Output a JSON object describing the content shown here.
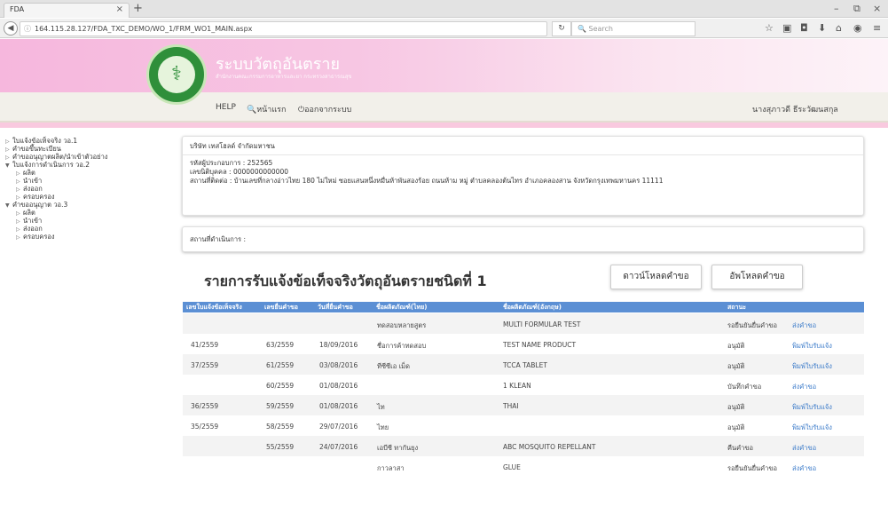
{
  "browser": {
    "tab_title": "FDA",
    "tab_close": "×",
    "new_tab": "+",
    "url": "164.115.28.127/FDA_TXC_DEMO/WO_1/FRM_WO1_MAIN.aspx",
    "search_placeholder": "Search",
    "window_controls": [
      "–",
      "⧉",
      "×"
    ]
  },
  "header": {
    "system_title": "ระบบวัตถุอันตราย",
    "system_subtitle": "สำนักงานคณะกรรมการอาหารและยา กระทรวงสาธารณสุข"
  },
  "menu": {
    "help": "HELP",
    "home": "หน้าแรก",
    "logout": "ออกจากระบบ",
    "user_name": "นางสุภาวดี ธีระวัฒนสกุล"
  },
  "sidebar": {
    "items": [
      {
        "label": "ใบแจ้งข้อเท็จจริง วอ.1",
        "expanded": false,
        "children": []
      },
      {
        "label": "คำขอขึ้นทะเบียน",
        "expanded": false,
        "children": []
      },
      {
        "label": "คำขออนุญาตผลิต/นำเข้าตัวอย่าง",
        "expanded": false,
        "children": []
      },
      {
        "label": "ใบแจ้งการดำเนินการ วอ.2",
        "expanded": true,
        "children": [
          "ผลิต",
          "นำเข้า",
          "ส่งออก",
          "ครอบครอง"
        ]
      },
      {
        "label": "คำขออนุญาต วอ.3",
        "expanded": true,
        "children": [
          "ผลิต",
          "นำเข้า",
          "ส่งออก",
          "ครอบครอง"
        ]
      }
    ]
  },
  "company": {
    "name": "บริษัท เทสโฮลด์ จำกัดมหาชน",
    "operator_id": "รหัสผู้ประกอบการ : 252565",
    "juristic_id": "เลขนิติบุคคล : 0000000000000",
    "address": "สถานที่ติดต่อ : บ้านเลขที่กลางอ่าวไทย 180 ไม่ใหม่ ซอยแสนหนึ่งหมื่นห้าพันสองร้อย ถนนห้าม หมู่ ตำบลคลองต้นไทร อำเภอคลองสาน จังหวัดกรุงเทพมหานคร 11111"
  },
  "location": {
    "label": "สถานที่ดำเนินการ :"
  },
  "main": {
    "title": "รายการรับแจ้งข้อเท็จจริงวัตถุอันตรายชนิดที่ 1",
    "download_button": "ดาวน์โหลดคำขอ",
    "upload_button": "อัพโหลดคำขอ"
  },
  "table": {
    "headers": [
      "เลขใบแจ้งข้อเท็จจริง",
      "เลขยื่นคำขอ",
      "วันที่ยื่นคำขอ",
      "ชื่อผลิตภัณฑ์(ไทย)",
      "ชื่อผลิตภัณฑ์(อังกฤษ)",
      "สถานะ",
      ""
    ],
    "rows": [
      {
        "notice_no": "",
        "req_no": "",
        "date": "",
        "name_th": "ทดสอบหลายสูตร",
        "name_en": "MULTI FORMULAR TEST",
        "status": "รอยืนยันยื่นคำขอ",
        "action": "ส่งคำขอ"
      },
      {
        "notice_no": "41/2559",
        "req_no": "63/2559",
        "date": "18/09/2016",
        "name_th": "ชื่อการค้าทดสอบ",
        "name_en": "TEST NAME PRODUCT",
        "status": "อนุมัติ",
        "action": "พิมพ์ใบรับแจ้ง"
      },
      {
        "notice_no": "37/2559",
        "req_no": "61/2559",
        "date": "03/08/2016",
        "name_th": "ทีซีซีเอ เม็ด",
        "name_en": "TCCA TABLET",
        "status": "อนุมัติ",
        "action": "พิมพ์ใบรับแจ้ง"
      },
      {
        "notice_no": "",
        "req_no": "60/2559",
        "date": "01/08/2016",
        "name_th": "",
        "name_en": "1 KLEAN",
        "status": "บันทึกคำขอ",
        "action": "ส่งคำขอ"
      },
      {
        "notice_no": "36/2559",
        "req_no": "59/2559",
        "date": "01/08/2016",
        "name_th": "ไท",
        "name_en": "THAI",
        "status": "อนุมัติ",
        "action": "พิมพ์ใบรับแจ้ง"
      },
      {
        "notice_no": "35/2559",
        "req_no": "58/2559",
        "date": "29/07/2016",
        "name_th": "ไทย",
        "name_en": "",
        "status": "อนุมัติ",
        "action": "พิมพ์ใบรับแจ้ง"
      },
      {
        "notice_no": "",
        "req_no": "55/2559",
        "date": "24/07/2016",
        "name_th": "เอบีซี ทากันยุง",
        "name_en": "ABC MOSQUITO REPELLANT",
        "status": "คืนคำขอ",
        "action": "ส่งคำขอ"
      },
      {
        "notice_no": "",
        "req_no": "",
        "date": "",
        "name_th": "กาวลาสา",
        "name_en": "GLUE",
        "status": "รอยืนยันยื่นคำขอ",
        "action": "ส่งคำขอ"
      }
    ]
  },
  "colors": {
    "banner_pink": "#f6b7dd",
    "table_header": "#5b8fd4",
    "link": "#3a7ac9",
    "logo_green": "#2f8f3a"
  }
}
